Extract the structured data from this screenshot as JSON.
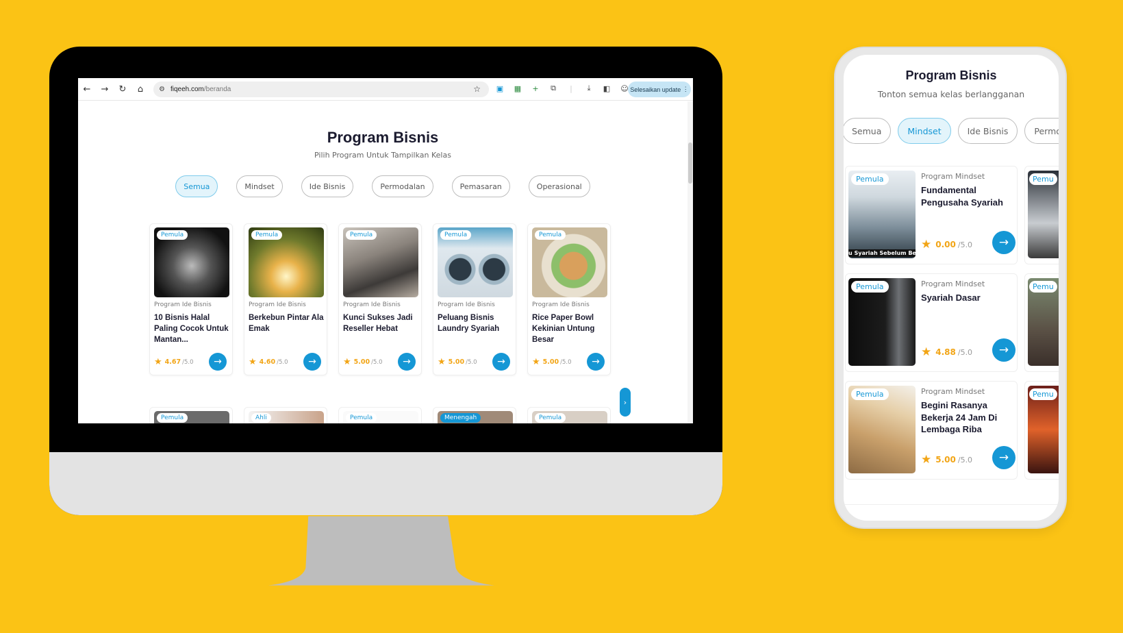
{
  "colors": {
    "background": "#FBC315",
    "accent": "#1597D5",
    "rating": "#F2A516"
  },
  "browser": {
    "url_domain": "fiqeeh.com",
    "url_path": "/beranda",
    "update_label": "Selesaikan update"
  },
  "desktop": {
    "title": "Program Bisnis",
    "subtitle": "Pilih Program Untuk Tampilkan Kelas",
    "tabs": [
      "Semua",
      "Mindset",
      "Ide Bisnis",
      "Permodalan",
      "Pemasaran",
      "Operasional"
    ],
    "active_tab": "Semua",
    "cards": [
      {
        "badge": "Pemula",
        "category": "Program Ide Bisnis",
        "name": "10 Bisnis Halal Paling Cocok Untuk Mantan...",
        "rating": "4.67",
        "max": "/5.0"
      },
      {
        "badge": "Pemula",
        "category": "Program Ide Bisnis",
        "name": "Berkebun Pintar Ala Emak",
        "rating": "4.60",
        "max": "/5.0"
      },
      {
        "badge": "Pemula",
        "category": "Program Ide Bisnis",
        "name": "Kunci Sukses Jadi Reseller Hebat",
        "rating": "5.00",
        "max": "/5.0"
      },
      {
        "badge": "Pemula",
        "category": "Program Ide Bisnis",
        "name": "Peluang Bisnis Laundry Syariah",
        "rating": "5.00",
        "max": "/5.0"
      },
      {
        "badge": "Pemula",
        "category": "Program Ide Bisnis",
        "name": "Rice Paper Bowl Kekinian Untung Besar",
        "rating": "5.00",
        "max": "/5.0"
      }
    ],
    "row2_badges": [
      "Pemula",
      "Ahli",
      "Pemula",
      "Menengah",
      "Pemula"
    ]
  },
  "mobile": {
    "title": "Program Bisnis",
    "subtitle": "Tonton semua kelas berlangganan",
    "tabs": [
      "Semua",
      "Mindset",
      "Ide Bisnis",
      "Permodalan"
    ],
    "tab_visible_text": [
      "Semua",
      "Mindset",
      "Ide Bisnis",
      "Permod"
    ],
    "active_tab": "Mindset",
    "cards": [
      {
        "badge": "Pemula",
        "category": "Program Mindset",
        "name": "Fundamental Pengusaha Syariah",
        "thumb_caption": "u Syariah Sebelum Ber",
        "rating": "0.00",
        "max": "/5.0"
      },
      {
        "badge": "Pemula",
        "category": "Program Mindset",
        "name": "Syariah Dasar",
        "rating": "4.88",
        "max": "/5.0"
      },
      {
        "badge": "Pemula",
        "category": "Program Mindset",
        "name": "Begini Rasanya Bekerja 24 Jam Di Lembaga Riba",
        "rating": "5.00",
        "max": "/5.0"
      }
    ],
    "peek_badges": [
      "Pemu",
      "Pemu",
      "Pemu"
    ]
  }
}
